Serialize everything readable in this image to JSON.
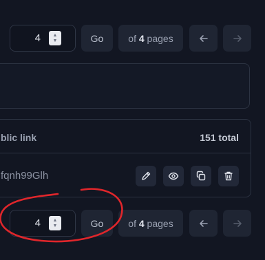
{
  "pagination_top": {
    "page_value": "4",
    "go_label": "Go",
    "of_label": "of",
    "total_pages": "4",
    "pages_label": "pages"
  },
  "table": {
    "column_header": "blic link",
    "total_count": "151 total",
    "rows": [
      {
        "link_text": "fqnh99Glh"
      }
    ]
  },
  "pagination_bottom": {
    "page_value": "4",
    "go_label": "Go",
    "of_label": "of",
    "total_pages": "4",
    "pages_label": "pages"
  },
  "colors": {
    "background": "#121622",
    "button_bg": "#1f2533",
    "border": "#2c3342",
    "annotation_red": "#e0262b"
  },
  "icons": {
    "row_actions": [
      "pencil-icon",
      "eye-icon",
      "copy-icon",
      "trash-icon"
    ],
    "nav": [
      "arrow-left-icon",
      "arrow-right-icon"
    ]
  }
}
